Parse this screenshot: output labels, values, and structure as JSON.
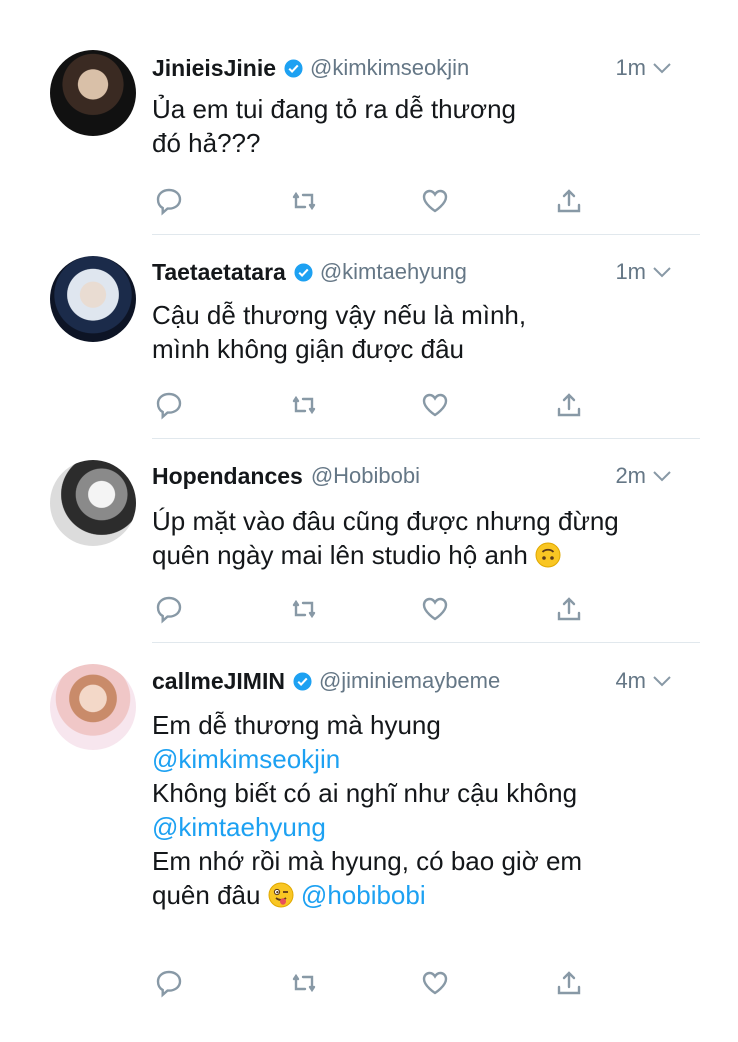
{
  "tweets": [
    {
      "name": "JinieisJinie",
      "handle": "@kimkimseokjin",
      "time": "1m",
      "lines": [
        "Ủa em tui đang tỏ ra dễ thương",
        "đó hả???"
      ]
    },
    {
      "name": "Taetaetatara",
      "handle": "@kimtaehyung",
      "time": "1m",
      "lines": [
        "Cậu dễ thương vậy nếu là mình,",
        "mình không giận được đâu"
      ]
    },
    {
      "name": "Hopendances",
      "handle": "@Hobibobi",
      "time": "2m",
      "lines": [
        "Úp mặt vào đâu cũng được nhưng đừng",
        "quên ngày mai lên studio hộ anh"
      ]
    },
    {
      "name": "callmeJIMIN",
      "handle": "@jiminiemaybeme",
      "time": "4m",
      "lines": [
        "Em dễ thương mà hyung",
        "@kimkimseokjin",
        "Không biết có ai nghĩ như cậu không",
        "@kimtaehyung",
        "Em nhớ rồi mà hyung, có bao giờ em",
        "quên đâu",
        "@hobibobi"
      ]
    }
  ],
  "colors": {
    "accent": "#1da1f2",
    "secondary": "#657786",
    "icon": "#8899a6",
    "divider": "#e1e8ed"
  }
}
